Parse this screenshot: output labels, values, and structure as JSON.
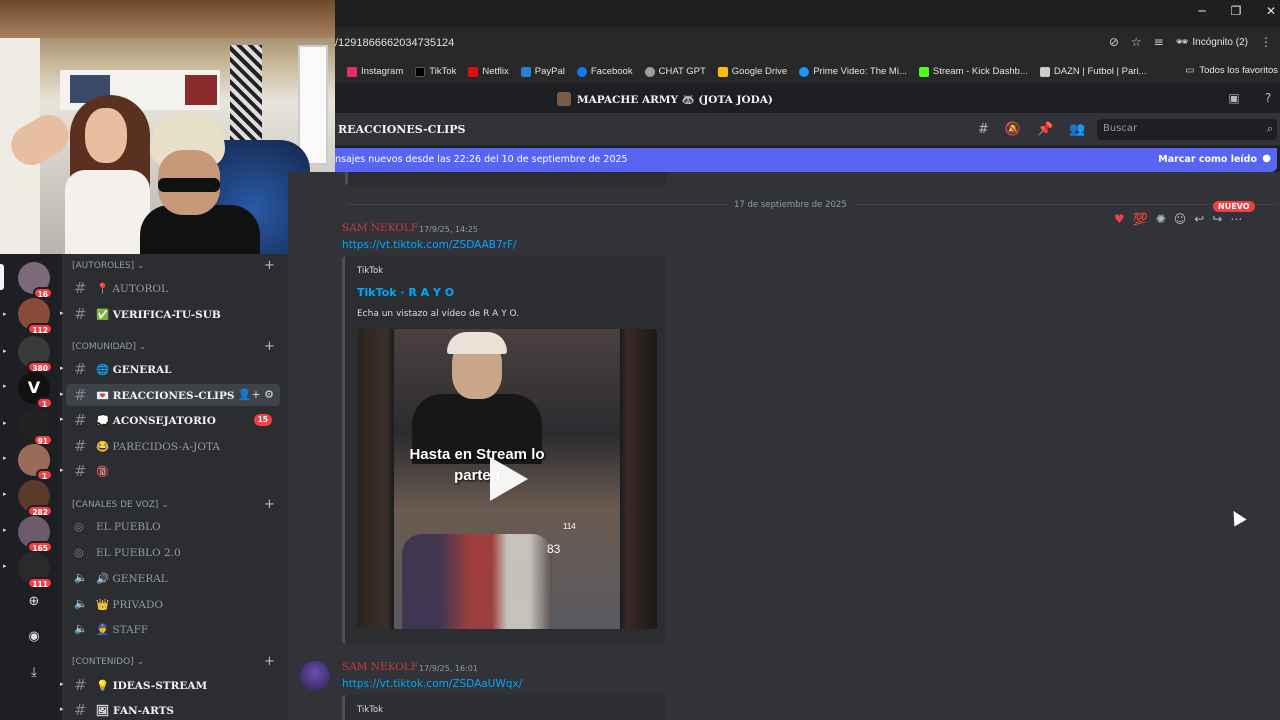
{
  "browser": {
    "url": "/1291866662034735124",
    "incognito_label": "Incógnito (2)",
    "bookmarks": [
      {
        "label": "Instagram",
        "color": "#e1306c"
      },
      {
        "label": "TikTok",
        "color": "#000000"
      },
      {
        "label": "Netflix",
        "color": "#e50914"
      },
      {
        "label": "PayPal",
        "color": "#2a7fd4"
      },
      {
        "label": "Facebook",
        "color": "#1877f2"
      },
      {
        "label": "CHAT GPT",
        "color": "#9aa0a6"
      },
      {
        "label": "Google Drive",
        "color": "#fbbc04"
      },
      {
        "label": "Prime Video: The Mi...",
        "color": "#1a98ff"
      },
      {
        "label": "Stream - Kick Dashb...",
        "color": "#53fc18"
      },
      {
        "label": "DAZN | Futbol | Pari...",
        "color": "#cccccc"
      }
    ],
    "all_bookmarks_label": "Todos los favoritos"
  },
  "discord": {
    "server_title": "MAPACHE ARMY 🦝 (JOTA JODA)",
    "channel_name": "REACCIONES-CLIPS",
    "search_placeholder": "Buscar",
    "new_messages_text": "nsajes nuevos desde las 22:26 del 10 de septiembre de 2025",
    "mark_read_label": "Marcar como leído",
    "date_divider": "17 de septiembre de 2025",
    "new_badge": "NUEVO",
    "messages": [
      {
        "author": "SAM NEKOLF",
        "timestamp": "17/9/25, 14:25",
        "link": "https://vt.tiktok.com/ZSDAAB7rF/",
        "embed_provider": "TikTok",
        "embed_title": "TikTok · R A Y O",
        "embed_desc": "Echa un vistazo al vídeo de R A Y O.",
        "video_overlay_text": "Hasta en Stream lo parten",
        "video_number": "83",
        "video_number_small": "114"
      },
      {
        "author": "SAM NEKOLF",
        "timestamp": "17/9/25, 16:01",
        "link": "https://vt.tiktok.com/ZSDAaUWqx/",
        "embed_provider": "TikTok"
      }
    ]
  },
  "sidebar": {
    "guild_badges": [
      "16",
      "112",
      "380",
      "1",
      "91",
      "1",
      "282",
      "165",
      "111"
    ],
    "categories": {
      "autoroles": "[AUTOROLES]",
      "comunidad": "[COMUNIDAD]",
      "canales_voz": "[CANALES DE VOZ]",
      "contenido": "[CONTENIDO]"
    },
    "channels": {
      "autorol": "📍 AUTOROL",
      "verifica": "✅ VERIFICA-TU-SUB",
      "general": "🌐 GENERAL",
      "reacciones": "💌 REACCIONES-CLIPS",
      "aconsejatorio": "💭 ACONSEJATORIO",
      "aconsejatorio_badge": "15",
      "parecidos": "😂 PARECIDOS-A-JOTA",
      "nsfw": "🔞",
      "el_pueblo": "EL PUEBLO",
      "el_pueblo_2": "EL PUEBLO 2.0",
      "general_voz": "🔊 GENERAL",
      "privado": "👑 PRIVADO",
      "staff": "👮 STAFF",
      "ideas_stream": "💡 IDEAS-STREAM",
      "fan_arts": "🖼 FAN-ARTS"
    }
  }
}
